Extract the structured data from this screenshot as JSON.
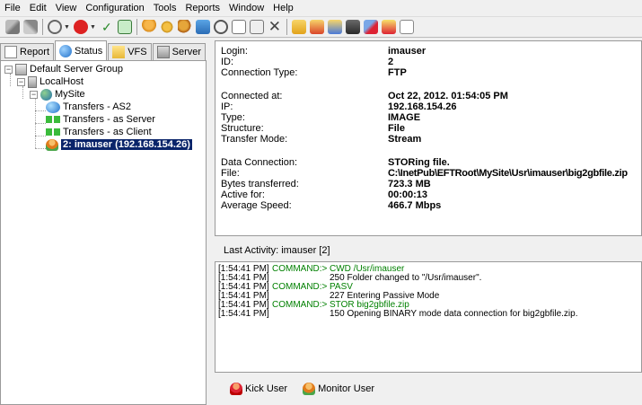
{
  "menu": [
    "File",
    "Edit",
    "View",
    "Configuration",
    "Tools",
    "Reports",
    "Window",
    "Help"
  ],
  "tabs": [
    {
      "label": "Report",
      "icon": "report-icon"
    },
    {
      "label": "Status",
      "icon": "status-globe-icon"
    },
    {
      "label": "VFS",
      "icon": "folder-icon"
    },
    {
      "label": "Server",
      "icon": "server-icon"
    }
  ],
  "tree": {
    "root": "Default Server Group",
    "host": "LocalHost",
    "site": "MySite",
    "items": [
      "Transfers - AS2",
      "Transfers - as Server",
      "Transfers - as Client"
    ],
    "selected_user": "2: imauser (192.168.154.26)"
  },
  "details": {
    "login_label": "Login:",
    "login": "imauser",
    "id_label": "ID:",
    "id": "2",
    "conn_type_label": "Connection Type:",
    "conn_type": "FTP",
    "connected_label": "Connected at:",
    "connected": "Oct 22, 2012. 01:54:05 PM",
    "ip_label": "IP:",
    "ip": "192.168.154.26",
    "type_label": "Type:",
    "type": "IMAGE",
    "structure_label": "Structure:",
    "structure": "File",
    "mode_label": "Transfer Mode:",
    "mode": "Stream",
    "data_conn_label": "Data Connection:",
    "data_conn": "STORing file.",
    "file_label": "File:",
    "file": "C:\\InetPub\\EFTRoot\\MySite\\Usr\\imauser\\big2gbfile.zip",
    "bytes_label": "Bytes transferred:",
    "bytes": "723.3 MB",
    "active_label": "Active for:",
    "active": "00:00:13",
    "speed_label": "Average Speed:",
    "speed": "466.7 Mbps"
  },
  "activity": {
    "title": "Last Activity: imauser [2]",
    "log": [
      {
        "time": "[1:54:41 PM]",
        "cmd": "COMMAND:>",
        "msg": "CWD /Usr/imauser",
        "green": true
      },
      {
        "time": "[1:54:41 PM]",
        "cmd": "",
        "msg": "250 Folder changed to \"/Usr/imauser\".",
        "green": false
      },
      {
        "time": "[1:54:41 PM]",
        "cmd": "COMMAND:>",
        "msg": "PASV",
        "green": true
      },
      {
        "time": "[1:54:41 PM]",
        "cmd": "",
        "msg": "227 Entering Passive Mode",
        "green": false
      },
      {
        "time": "[1:54:41 PM]",
        "cmd": "COMMAND:>",
        "msg": "STOR big2gbfile.zip",
        "green": true
      },
      {
        "time": "[1:54:41 PM]",
        "cmd": "",
        "msg": "150 Opening BINARY mode data connection for big2gbfile.zip.",
        "green": false
      }
    ]
  },
  "actions": {
    "kick": "Kick User",
    "monitor": "Monitor User"
  }
}
